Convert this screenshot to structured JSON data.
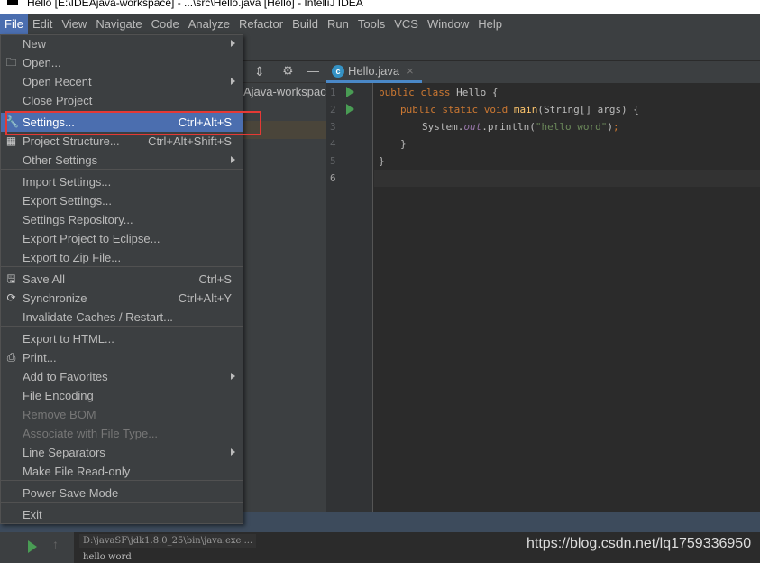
{
  "window": {
    "title": "Hello [E:\\IDEAjava-workspace] - ...\\src\\Hello.java [Hello] - IntelliJ IDEA"
  },
  "menubar": [
    "File",
    "Edit",
    "View",
    "Navigate",
    "Code",
    "Analyze",
    "Refactor",
    "Build",
    "Run",
    "Tools",
    "VCS",
    "Window",
    "Help"
  ],
  "project": {
    "path": "Ajava-workspace"
  },
  "editor": {
    "tab": "Hello.java",
    "lines": [
      "1",
      "2",
      "3",
      "4",
      "5",
      "6"
    ]
  },
  "file_menu": [
    {
      "label": "New",
      "submenu": true
    },
    {
      "label": "Open...",
      "icon": "folder-icon"
    },
    {
      "label": "Open Recent",
      "submenu": true
    },
    {
      "label": "Close Project"
    },
    {
      "label": "Settings...",
      "shortcut": "Ctrl+Alt+S",
      "icon": "wrench-icon",
      "selected": true
    },
    {
      "label": "Project Structure...",
      "shortcut": "Ctrl+Alt+Shift+S",
      "icon": "project-structure-icon"
    },
    {
      "label": "Other Settings",
      "submenu": true
    },
    {
      "label": "Import Settings..."
    },
    {
      "label": "Export Settings..."
    },
    {
      "label": "Settings Repository..."
    },
    {
      "label": "Export Project to Eclipse..."
    },
    {
      "label": "Export to Zip File..."
    },
    {
      "label": "Save All",
      "shortcut": "Ctrl+S",
      "icon": "save-icon"
    },
    {
      "label": "Synchronize",
      "shortcut": "Ctrl+Alt+Y",
      "icon": "sync-icon"
    },
    {
      "label": "Invalidate Caches / Restart..."
    },
    {
      "label": "Export to HTML..."
    },
    {
      "label": "Print...",
      "icon": "print-icon"
    },
    {
      "label": "Add to Favorites",
      "submenu": true
    },
    {
      "label": "File Encoding"
    },
    {
      "label": "Remove BOM",
      "disabled": true
    },
    {
      "label": "Associate with File Type...",
      "disabled": true
    },
    {
      "label": "Line Separators",
      "submenu": true
    },
    {
      "label": "Make File Read-only"
    },
    {
      "label": "Power Save Mode"
    },
    {
      "label": "Exit"
    }
  ],
  "console": {
    "command": "D:\\javaSF\\jdk1.8.0_25\\bin\\java.exe ...",
    "output": "hello word"
  },
  "watermark": "https://blog.csdn.net/lq1759336950",
  "colors": {
    "accent": "#4b6eaf",
    "highlight_box": "#e53935"
  }
}
